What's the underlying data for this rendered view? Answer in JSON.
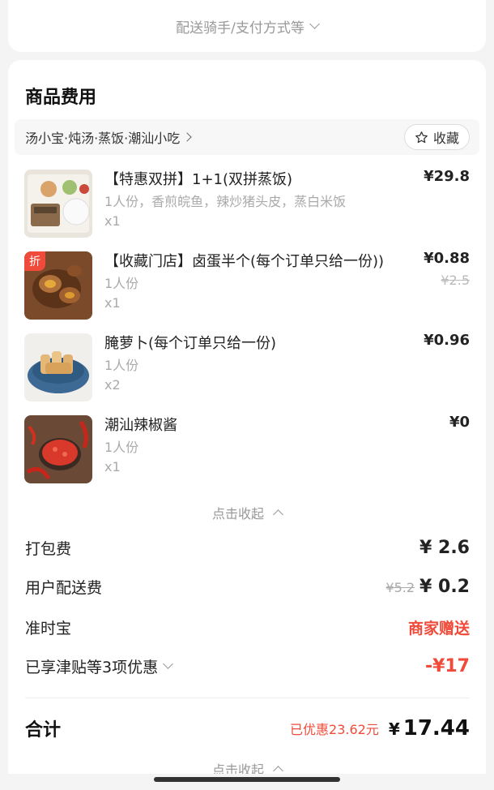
{
  "top": {
    "delivery_options": "配送骑手/支付方式等"
  },
  "section": {
    "title": "商品费用"
  },
  "shop": {
    "name": "汤小宝·炖汤·蒸饭·潮汕小吃",
    "favorite_label": "收藏"
  },
  "items": [
    {
      "name": "【特惠双拼】1+1(双拼蒸饭)",
      "desc": "1人份，香煎皖鱼，辣炒猪头皮，蒸白米饭",
      "qty": "x1",
      "price": "¥29.8",
      "old_price": "",
      "badge": ""
    },
    {
      "name": "【收藏门店】卤蛋半个(每个订单只给一份))",
      "desc": "1人份",
      "qty": "x1",
      "price": "¥0.88",
      "old_price": "¥2.5",
      "badge": "折"
    },
    {
      "name": "腌萝卜(每个订单只给一份)",
      "desc": "1人份",
      "qty": "x2",
      "price": "¥0.96",
      "old_price": "",
      "badge": ""
    },
    {
      "name": "潮汕辣椒酱",
      "desc": "1人份",
      "qty": "x1",
      "price": "¥0",
      "old_price": "",
      "badge": ""
    }
  ],
  "collapse_label": "点击收起",
  "fees": {
    "packing_label": "打包费",
    "packing_value": "¥ 2.6",
    "delivery_label": "用户配送费",
    "delivery_old": "¥5.2",
    "delivery_value": "¥ 0.2",
    "ontime_label": "准时宝",
    "ontime_value": "商家赠送",
    "discount_label": "已享津贴等3项优惠",
    "discount_value": "-¥17"
  },
  "total": {
    "label": "合计",
    "saved": "已优惠23.62元",
    "currency": "¥",
    "value": "17.44"
  },
  "colors": {
    "accent_red": "#f04b3a"
  }
}
